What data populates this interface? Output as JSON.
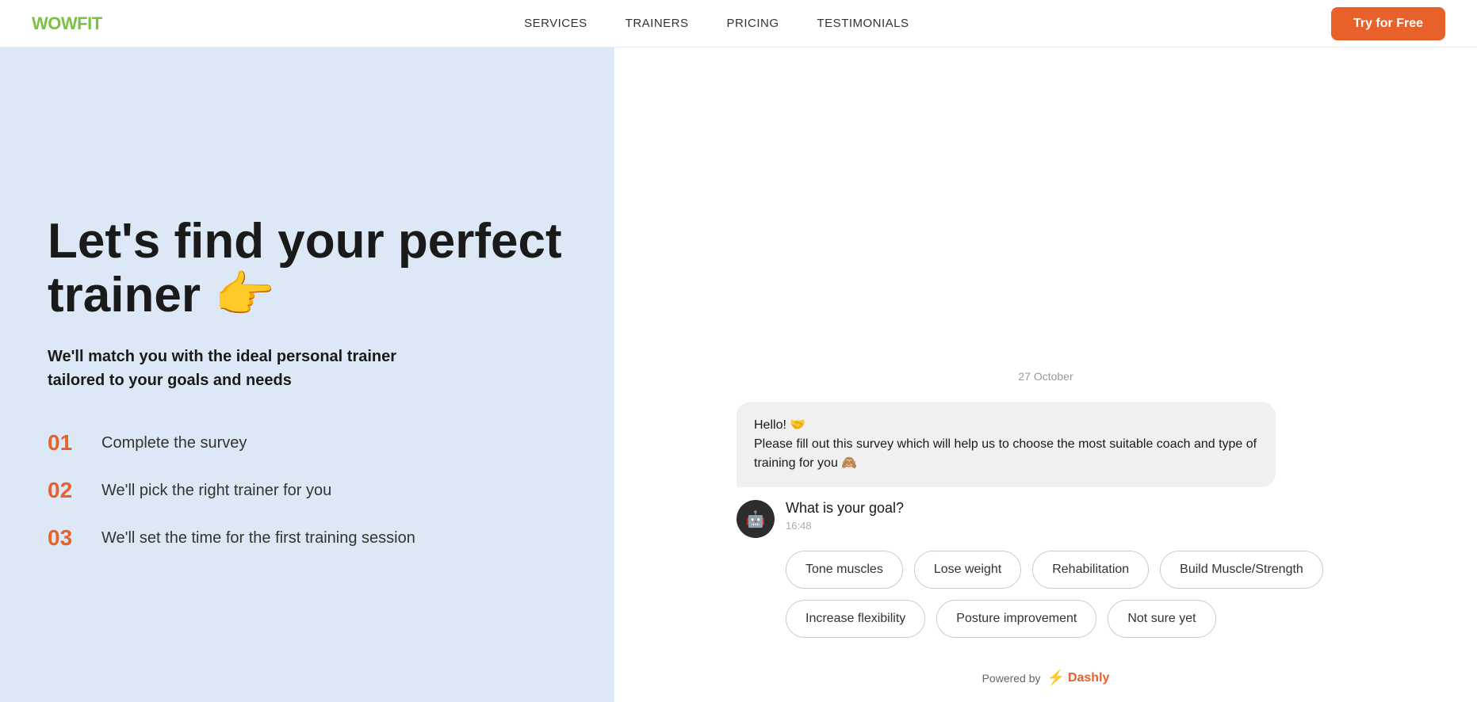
{
  "nav": {
    "logo_main": "WOW",
    "logo_accent": "FIT",
    "links": [
      {
        "label": "SERVICES",
        "id": "services"
      },
      {
        "label": "TRAINERS",
        "id": "trainers"
      },
      {
        "label": "PRICING",
        "id": "pricing"
      },
      {
        "label": "TESTIMONIALS",
        "id": "testimonials"
      }
    ],
    "cta_label": "Try for Free"
  },
  "hero": {
    "title": "Let's find your perfect trainer 👉",
    "subtitle": "We'll match you with the ideal personal trainer tailored to your goals and needs",
    "steps": [
      {
        "num": "01",
        "text": "Complete the survey"
      },
      {
        "num": "02",
        "text": "We'll pick the right trainer for you"
      },
      {
        "num": "03",
        "text": "We'll set the time for the first training session"
      }
    ]
  },
  "chat": {
    "date": "27 October",
    "greeting": "Hello! 🤝",
    "greeting_body": "Please fill out this survey which will help us to choose the most suitable coach and type of training for you 🙈",
    "bot_question": "What is your goal?",
    "bot_time": "16:48",
    "options": [
      "Tone muscles",
      "Lose weight",
      "Rehabilitation",
      "Build Muscle/Strength",
      "Increase flexibility",
      "Posture improvement",
      "Not sure yet"
    ],
    "powered_by_label": "Powered by",
    "powered_by_brand": "Dashly"
  }
}
